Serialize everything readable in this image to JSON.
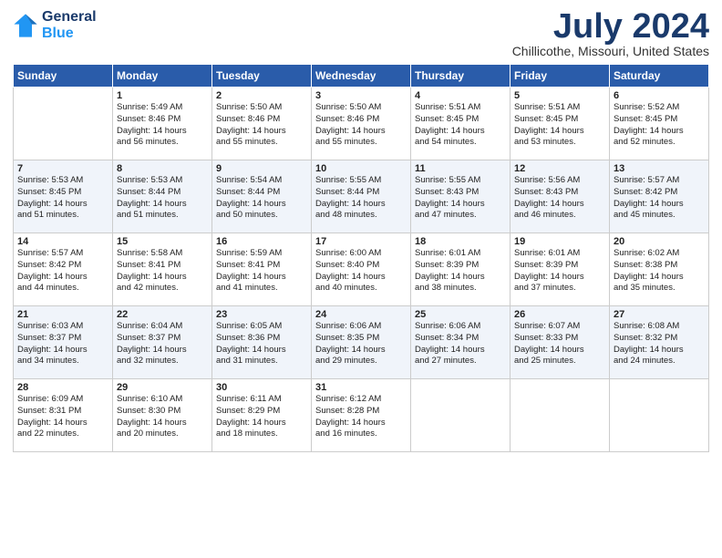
{
  "logo": {
    "line1": "General",
    "line2": "Blue"
  },
  "title": "July 2024",
  "location": "Chillicothe, Missouri, United States",
  "days_of_week": [
    "Sunday",
    "Monday",
    "Tuesday",
    "Wednesday",
    "Thursday",
    "Friday",
    "Saturday"
  ],
  "weeks": [
    [
      {
        "num": "",
        "info": ""
      },
      {
        "num": "1",
        "info": "Sunrise: 5:49 AM\nSunset: 8:46 PM\nDaylight: 14 hours\nand 56 minutes."
      },
      {
        "num": "2",
        "info": "Sunrise: 5:50 AM\nSunset: 8:46 PM\nDaylight: 14 hours\nand 55 minutes."
      },
      {
        "num": "3",
        "info": "Sunrise: 5:50 AM\nSunset: 8:46 PM\nDaylight: 14 hours\nand 55 minutes."
      },
      {
        "num": "4",
        "info": "Sunrise: 5:51 AM\nSunset: 8:45 PM\nDaylight: 14 hours\nand 54 minutes."
      },
      {
        "num": "5",
        "info": "Sunrise: 5:51 AM\nSunset: 8:45 PM\nDaylight: 14 hours\nand 53 minutes."
      },
      {
        "num": "6",
        "info": "Sunrise: 5:52 AM\nSunset: 8:45 PM\nDaylight: 14 hours\nand 52 minutes."
      }
    ],
    [
      {
        "num": "7",
        "info": "Sunrise: 5:53 AM\nSunset: 8:45 PM\nDaylight: 14 hours\nand 51 minutes."
      },
      {
        "num": "8",
        "info": "Sunrise: 5:53 AM\nSunset: 8:44 PM\nDaylight: 14 hours\nand 51 minutes."
      },
      {
        "num": "9",
        "info": "Sunrise: 5:54 AM\nSunset: 8:44 PM\nDaylight: 14 hours\nand 50 minutes."
      },
      {
        "num": "10",
        "info": "Sunrise: 5:55 AM\nSunset: 8:44 PM\nDaylight: 14 hours\nand 48 minutes."
      },
      {
        "num": "11",
        "info": "Sunrise: 5:55 AM\nSunset: 8:43 PM\nDaylight: 14 hours\nand 47 minutes."
      },
      {
        "num": "12",
        "info": "Sunrise: 5:56 AM\nSunset: 8:43 PM\nDaylight: 14 hours\nand 46 minutes."
      },
      {
        "num": "13",
        "info": "Sunrise: 5:57 AM\nSunset: 8:42 PM\nDaylight: 14 hours\nand 45 minutes."
      }
    ],
    [
      {
        "num": "14",
        "info": "Sunrise: 5:57 AM\nSunset: 8:42 PM\nDaylight: 14 hours\nand 44 minutes."
      },
      {
        "num": "15",
        "info": "Sunrise: 5:58 AM\nSunset: 8:41 PM\nDaylight: 14 hours\nand 42 minutes."
      },
      {
        "num": "16",
        "info": "Sunrise: 5:59 AM\nSunset: 8:41 PM\nDaylight: 14 hours\nand 41 minutes."
      },
      {
        "num": "17",
        "info": "Sunrise: 6:00 AM\nSunset: 8:40 PM\nDaylight: 14 hours\nand 40 minutes."
      },
      {
        "num": "18",
        "info": "Sunrise: 6:01 AM\nSunset: 8:39 PM\nDaylight: 14 hours\nand 38 minutes."
      },
      {
        "num": "19",
        "info": "Sunrise: 6:01 AM\nSunset: 8:39 PM\nDaylight: 14 hours\nand 37 minutes."
      },
      {
        "num": "20",
        "info": "Sunrise: 6:02 AM\nSunset: 8:38 PM\nDaylight: 14 hours\nand 35 minutes."
      }
    ],
    [
      {
        "num": "21",
        "info": "Sunrise: 6:03 AM\nSunset: 8:37 PM\nDaylight: 14 hours\nand 34 minutes."
      },
      {
        "num": "22",
        "info": "Sunrise: 6:04 AM\nSunset: 8:37 PM\nDaylight: 14 hours\nand 32 minutes."
      },
      {
        "num": "23",
        "info": "Sunrise: 6:05 AM\nSunset: 8:36 PM\nDaylight: 14 hours\nand 31 minutes."
      },
      {
        "num": "24",
        "info": "Sunrise: 6:06 AM\nSunset: 8:35 PM\nDaylight: 14 hours\nand 29 minutes."
      },
      {
        "num": "25",
        "info": "Sunrise: 6:06 AM\nSunset: 8:34 PM\nDaylight: 14 hours\nand 27 minutes."
      },
      {
        "num": "26",
        "info": "Sunrise: 6:07 AM\nSunset: 8:33 PM\nDaylight: 14 hours\nand 25 minutes."
      },
      {
        "num": "27",
        "info": "Sunrise: 6:08 AM\nSunset: 8:32 PM\nDaylight: 14 hours\nand 24 minutes."
      }
    ],
    [
      {
        "num": "28",
        "info": "Sunrise: 6:09 AM\nSunset: 8:31 PM\nDaylight: 14 hours\nand 22 minutes."
      },
      {
        "num": "29",
        "info": "Sunrise: 6:10 AM\nSunset: 8:30 PM\nDaylight: 14 hours\nand 20 minutes."
      },
      {
        "num": "30",
        "info": "Sunrise: 6:11 AM\nSunset: 8:29 PM\nDaylight: 14 hours\nand 18 minutes."
      },
      {
        "num": "31",
        "info": "Sunrise: 6:12 AM\nSunset: 8:28 PM\nDaylight: 14 hours\nand 16 minutes."
      },
      {
        "num": "",
        "info": ""
      },
      {
        "num": "",
        "info": ""
      },
      {
        "num": "",
        "info": ""
      }
    ]
  ]
}
